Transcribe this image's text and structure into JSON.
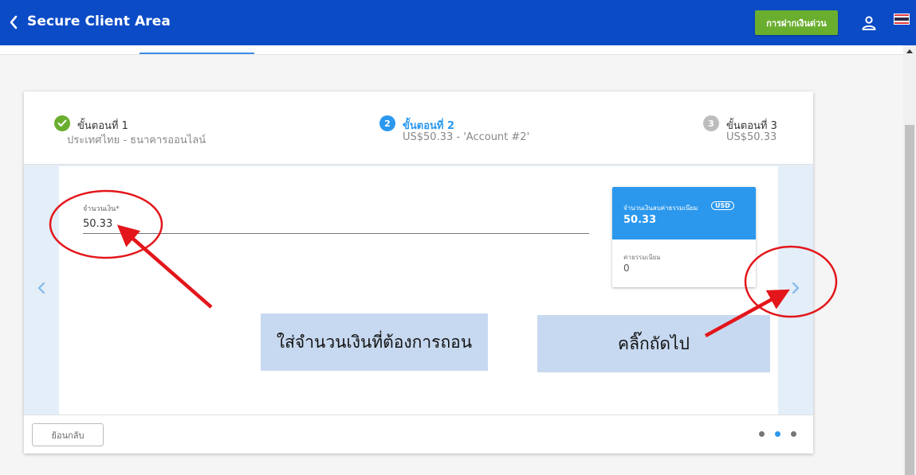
{
  "header": {
    "title": "Secure Client Area",
    "deposit_button": "การฝากเงินด่วน",
    "colors": {
      "bar": "#0c4bc6",
      "deposit": "#6aae2f"
    }
  },
  "steps": [
    {
      "number": "1",
      "title": "ขั้นตอนที่ 1",
      "subtitle": "ประเทศไทย - ธนาคารออนไลน์",
      "state": "done"
    },
    {
      "number": "2",
      "title": "ขั้นตอนที่ 2",
      "subtitle": "US$50.33 - 'Account #2'",
      "state": "active"
    },
    {
      "number": "3",
      "title": "ขั้นตอนที่ 3",
      "subtitle": "US$50.33",
      "state": "pending"
    }
  ],
  "form": {
    "amount_label": "จำนวนเงิน*",
    "amount_value": "50.33"
  },
  "summary": {
    "label": "จำนวนเงินลบค่าธรรมเนียม",
    "currency": "USD",
    "value": "50.33",
    "fee_label": "ค่าธรรมเนียม",
    "fee_value": "0"
  },
  "annotations": {
    "enter_amount": "ใส่จำนวนเงินที่ต้องการถอน",
    "click_next": "คลิ๊กถัดไป"
  },
  "footer": {
    "back_button": "ย้อนกลับ",
    "dots_total": 3,
    "dots_active_index": 1
  },
  "icons": {
    "back": "chevron-left-icon",
    "user": "user-icon",
    "flag": "thailand-flag-icon",
    "prev": "chevron-left-icon",
    "next": "chevron-right-icon",
    "check": "check-icon"
  }
}
